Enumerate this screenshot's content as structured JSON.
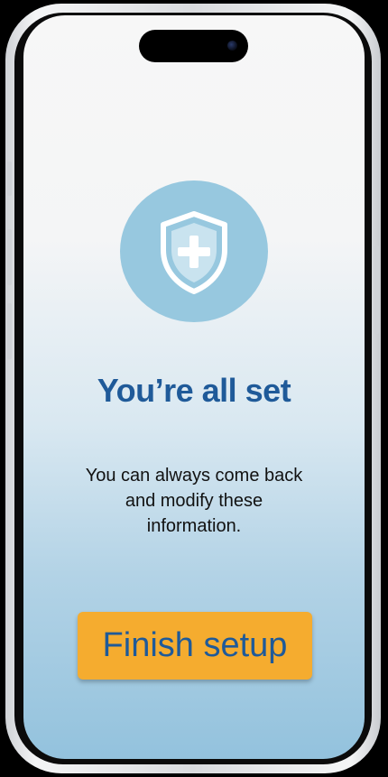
{
  "onboarding": {
    "icon": "shield-plus-icon",
    "title": "You’re all set",
    "message": "You can always come back and modify these information.",
    "finish_label": "Finish setup"
  },
  "colors": {
    "title": "#1f5a99",
    "button_bg": "#f5ac2f",
    "icon_circle": "#97c8df"
  }
}
